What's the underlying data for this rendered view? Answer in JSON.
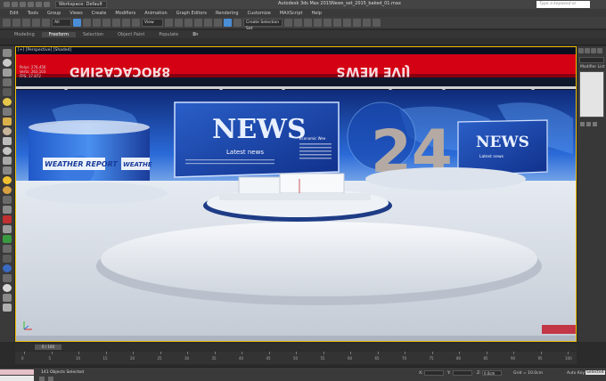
{
  "titlebar": {
    "workspace": "Workspace: Default",
    "app_title": "Autodesk 3ds Max 2015",
    "file_title": "News_set_2015_baked_01.max",
    "help_search_placeholder": "Type a keyword or phrase"
  },
  "menu": [
    "Edit",
    "Tools",
    "Group",
    "Views",
    "Create",
    "Modifiers",
    "Animation",
    "Graph Editors",
    "Rendering",
    "Customize",
    "MAXScript",
    "Help"
  ],
  "toolbar": {
    "selection_filter": "All",
    "reference_coord": "View",
    "named_selection": "Create Selection Set"
  },
  "ribbon": {
    "tabs": [
      "Modeling",
      "Freeform",
      "Selection",
      "Object Paint",
      "Populate"
    ],
    "active_tab": "Freeform"
  },
  "viewport": {
    "label": "[+] [Perspective] [Shaded]",
    "stats": {
      "polys_label": "Polys:",
      "polys_value": "276,456",
      "verts_label": "Verts:",
      "verts_value": "263,103",
      "fps_label": "FPS:",
      "fps_value": "17.872"
    },
    "scene": {
      "screen_left_title": "NEWS",
      "screen_left_sub": "Latest news",
      "screen_left_col": "Economic Wee",
      "screen_right_title": "NEWS",
      "screen_right_sub": "Latest news",
      "big_number": "24",
      "weather_label": "WEATHER REPORT",
      "weather_label_short": "WEATHE"
    }
  },
  "right_panel": {
    "modifier_list": "Modifier List"
  },
  "timeline": {
    "frame": "0 / 100",
    "ticks": [
      "0",
      "5",
      "10",
      "15",
      "20",
      "25",
      "30",
      "35",
      "40",
      "45",
      "50",
      "55",
      "60",
      "65",
      "70",
      "75",
      "80",
      "85",
      "90",
      "95",
      "100"
    ]
  },
  "status": {
    "selection": "141 Objects Selected",
    "x_label": "X:",
    "x_value": "",
    "y_label": "Y:",
    "y_value": "",
    "z_label": "Z:",
    "z_value": "0.0cm",
    "grid": "Grid = 10.0cm",
    "auto_key": "Auto Key",
    "selected_btn": "Selected"
  },
  "colors": {
    "selection_border": "#f0c000",
    "studio_blue": "#1e4fb0",
    "banner_red": "#d40014",
    "floor": "#d8dde6"
  }
}
